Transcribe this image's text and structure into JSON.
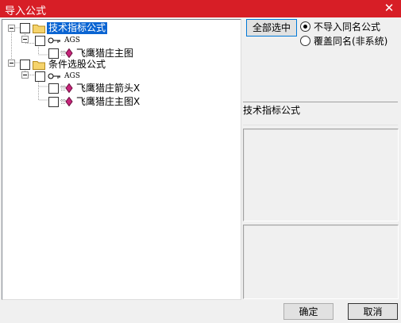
{
  "window": {
    "title": "导入公式",
    "close_glyph": "✕"
  },
  "tree": {
    "nodes": [
      {
        "label": "技术指标公式",
        "type": "folder",
        "selected": true
      },
      {
        "label": "AGS",
        "type": "key"
      },
      {
        "label": "飞鹰猎庄主图",
        "type": "formula"
      },
      {
        "label": "条件选股公式",
        "type": "folder"
      },
      {
        "label": "AGS",
        "type": "key"
      },
      {
        "label": "飞鹰猎庄箭头X",
        "type": "formula"
      },
      {
        "label": "飞鹰猎庄主图X",
        "type": "formula"
      }
    ]
  },
  "options": {
    "select_all_label": "全部选中",
    "radio_no_import": "不导入同名公式",
    "radio_overwrite": "覆盖同名(非系统)",
    "selected_radio": "radio_no_import"
  },
  "info": {
    "category_label": "技术指标公式"
  },
  "footer": {
    "ok_label": "确定",
    "cancel_label": "取消"
  },
  "colors": {
    "title_bar": "#d71e26",
    "selection": "#0a64d2",
    "folder": "#f5d36b",
    "formula_icon": "#c7247a"
  }
}
